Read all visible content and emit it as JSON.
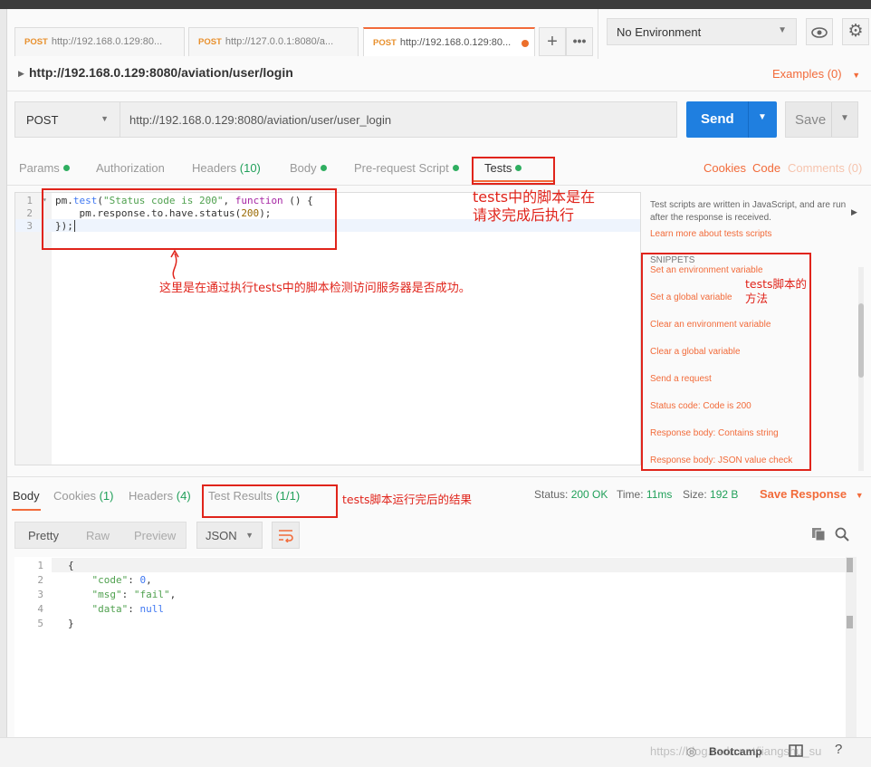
{
  "tabs": [
    {
      "method": "POST",
      "url": "http://192.168.0.129:80..."
    },
    {
      "method": "POST",
      "url": "http://127.0.0.1:8080/a..."
    },
    {
      "method": "POST",
      "url": "http://192.168.0.129:80..."
    }
  ],
  "environment": {
    "selected": "No Environment"
  },
  "request": {
    "title": "http://192.168.0.129:8080/aviation/user/login",
    "examples": "Examples (0)",
    "method": "POST",
    "url": "http://192.168.0.129:8080/aviation/user/user_login",
    "send": "Send",
    "save": "Save"
  },
  "subtabs": {
    "params": "Params",
    "authorization": "Authorization",
    "headers": "Headers",
    "headers_count": "(10)",
    "body": "Body",
    "prerequest": "Pre-request Script",
    "tests": "Tests",
    "cookies": "Cookies",
    "code": "Code",
    "comments": "Comments (0)"
  },
  "script": {
    "line_numbers": [
      "1",
      "2",
      "3"
    ],
    "line1_a": "pm.",
    "line1_fn": "test",
    "line1_b": "(",
    "line1_str": "\"Status code is 200\"",
    "line1_c": ", ",
    "line1_kw": "function",
    "line1_d": " () {",
    "line2_a": "    pm.response.to.have.status(",
    "line2_num": "200",
    "line2_b": ");",
    "line3": "});"
  },
  "sidebar": {
    "description": "Test scripts are written in JavaScript, and are run after the response is received.",
    "learn_more": "Learn more about tests scripts",
    "snippets_heading": "SNIPPETS",
    "snippets": [
      "Set an environment variable",
      "Set a global variable",
      "Clear an environment variable",
      "Clear a global variable",
      "Send a request",
      "Status code: Code is 200",
      "Response body: Contains string",
      "Response body: JSON value check"
    ]
  },
  "annotations": {
    "tests_note_1": "tests中的脚本是在",
    "tests_note_2": "请求完成后执行",
    "script_note": "这里是在通过执行tests中的脚本检测访问服务器是否成功。",
    "snippets_note_1": "tests脚本的",
    "snippets_note_2": "方法",
    "results_note": "tests脚本运行完后的结果"
  },
  "response": {
    "tabs": {
      "body": "Body",
      "cookies": "Cookies",
      "cookies_count": "(1)",
      "headers": "Headers",
      "headers_count": "(4)",
      "test_results": "Test Results",
      "test_results_count": "(1/1)"
    },
    "status_label": "Status:",
    "status_value": "200 OK",
    "time_label": "Time:",
    "time_value": "11ms",
    "size_label": "Size:",
    "size_value": "192 B",
    "save_response": "Save Response",
    "formats": [
      "Pretty",
      "Raw",
      "Preview"
    ],
    "format_type": "JSON",
    "body_line_numbers": [
      "1",
      "2",
      "3",
      "4",
      "5"
    ],
    "body_open": "{",
    "code_key": "\"code\"",
    "code_value": "0",
    "msg_key": "\"msg\"",
    "msg_value": "\"fail\"",
    "data_key": "\"data\"",
    "data_value": "null",
    "body_close": "}"
  },
  "footer": {
    "bootcamp": "Bootcamp",
    "watermark": "https://blog.csdn.net/jiangshu_su"
  },
  "colors": {
    "accent_orange": "#f26b3a",
    "send_blue": "#1f7fe0",
    "status_green": "#21a05a",
    "annotation_red": "#e0241b"
  }
}
